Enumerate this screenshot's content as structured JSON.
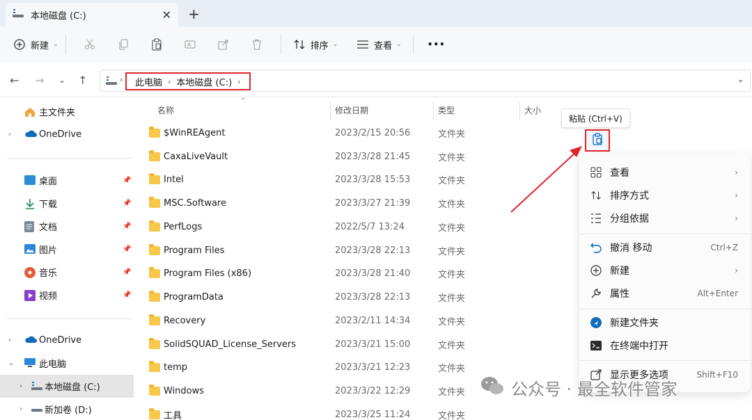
{
  "window": {
    "tab_title": "本地磁盘 (C:)",
    "close_glyph": "✕",
    "newtab_glyph": "+"
  },
  "toolbar": {
    "new_label": "新建",
    "sort_label": "排序",
    "view_label": "查看",
    "more_glyph": "•••"
  },
  "address": {
    "crumbs": [
      "此电脑",
      "本地磁盘 (C:)"
    ]
  },
  "sidebar": {
    "home": "主文件夹",
    "onedrive_top": "OneDrive",
    "quick": [
      "桌面",
      "下载",
      "文档",
      "图片",
      "音乐",
      "视频"
    ],
    "onedrive_bottom": "OneDrive",
    "this_pc": "此电脑",
    "drive_c": "本地磁盘 (C:)",
    "drive_d": "新加卷 (D:)"
  },
  "columns": {
    "name": "名称",
    "date": "修改日期",
    "type": "类型",
    "size": "大小"
  },
  "files": [
    {
      "name": "$WinREAgent",
      "date": "2023/2/15 20:56",
      "type": "文件夹"
    },
    {
      "name": "CaxaLiveVault",
      "date": "2023/3/28 21:45",
      "type": "文件夹"
    },
    {
      "name": "Intel",
      "date": "2023/3/28 15:53",
      "type": "文件夹"
    },
    {
      "name": "MSC.Software",
      "date": "2023/3/27 21:39",
      "type": "文件夹"
    },
    {
      "name": "PerfLogs",
      "date": "2022/5/7 13:24",
      "type": "文件夹"
    },
    {
      "name": "Program Files",
      "date": "2023/3/28 22:13",
      "type": "文件夹"
    },
    {
      "name": "Program Files (x86)",
      "date": "2023/3/28 21:40",
      "type": "文件夹"
    },
    {
      "name": "ProgramData",
      "date": "2023/3/28 22:13",
      "type": "文件夹"
    },
    {
      "name": "Recovery",
      "date": "2023/2/11 14:34",
      "type": "文件夹"
    },
    {
      "name": "SolidSQUAD_License_Servers",
      "date": "2023/3/21 15:00",
      "type": "文件夹"
    },
    {
      "name": "temp",
      "date": "2023/3/21 12:23",
      "type": "文件夹"
    },
    {
      "name": "Windows",
      "date": "2023/3/22 12:29",
      "type": "文件夹"
    },
    {
      "name": "工具",
      "date": "2023/3/25 11:24",
      "type": "文件夹"
    }
  ],
  "tooltip": "粘贴 (Ctrl+V)",
  "context_menu": {
    "view": "查看",
    "sort": "排序方式",
    "group": "分组依据",
    "undo": "撤消 移动",
    "undo_shortcut": "Ctrl+Z",
    "new": "新建",
    "properties": "属性",
    "properties_shortcut": "Alt+Enter",
    "new_folder": "新建文件夹",
    "open_terminal": "在终端中打开",
    "more_options": "显示更多选项",
    "more_shortcut": "Shift+F10"
  },
  "watermark": "公众号 · 最全软件管家",
  "colors": {
    "accent": "#0067c0",
    "highlight_red": "#e0242b",
    "folder": "#f8c84a"
  }
}
